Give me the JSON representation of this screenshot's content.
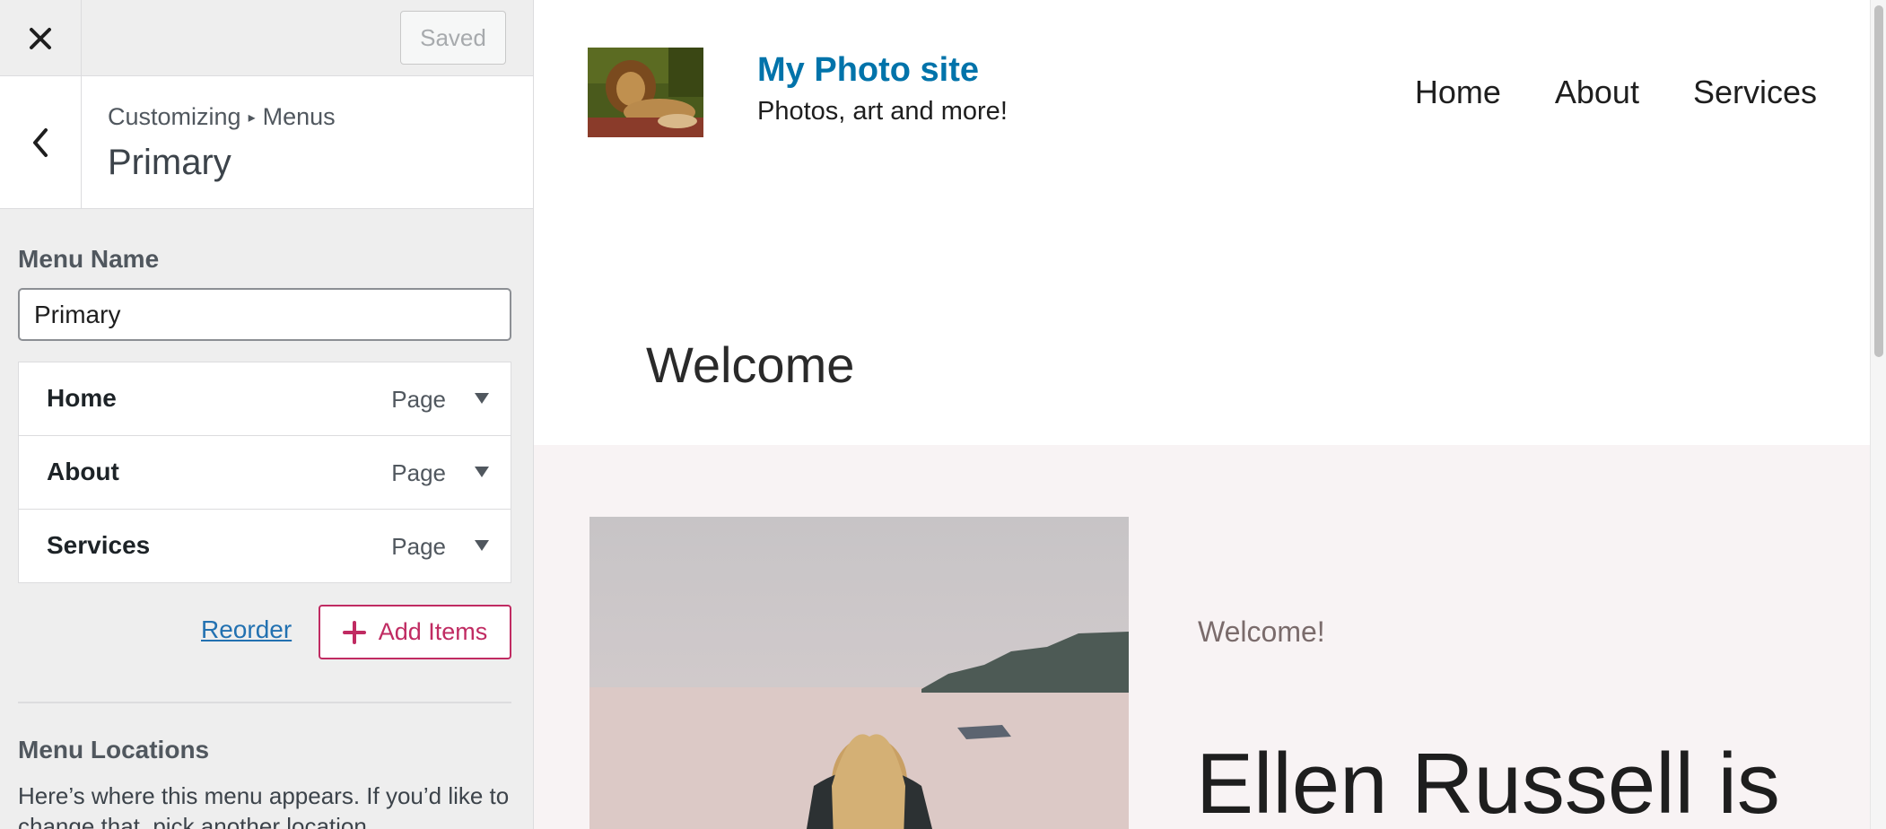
{
  "customizer": {
    "close_icon": "close-icon",
    "saved_label": "Saved",
    "back_icon": "chevron-left-icon",
    "breadcrumb": {
      "root": "Customizing",
      "separator": "▸",
      "current": "Menus"
    },
    "section_title": "Primary",
    "menu_name_label": "Menu Name",
    "menu_name_value": "Primary",
    "menu_items": [
      {
        "title": "Home",
        "type": "Page"
      },
      {
        "title": "About",
        "type": "Page"
      },
      {
        "title": "Services",
        "type": "Page"
      }
    ],
    "reorder_label": "Reorder",
    "add_items_label": "Add Items",
    "menu_locations_label": "Menu Locations",
    "menu_locations_desc": "Here’s where this menu appears. If you’d like to change that, pick another location."
  },
  "site": {
    "title": "My Photo site",
    "tagline": "Photos, art and more!",
    "nav": [
      "Home",
      "About",
      "Services"
    ],
    "welcome_heading": "Welcome",
    "hero_eyebrow": "Welcome!",
    "hero_title": "Ellen Russell is"
  },
  "colors": {
    "accent_blue": "#0073aa",
    "add_items_accent": "#c02b62",
    "sidebar_bg": "#eeeeee",
    "hero_bg": "#f8f3f4"
  }
}
